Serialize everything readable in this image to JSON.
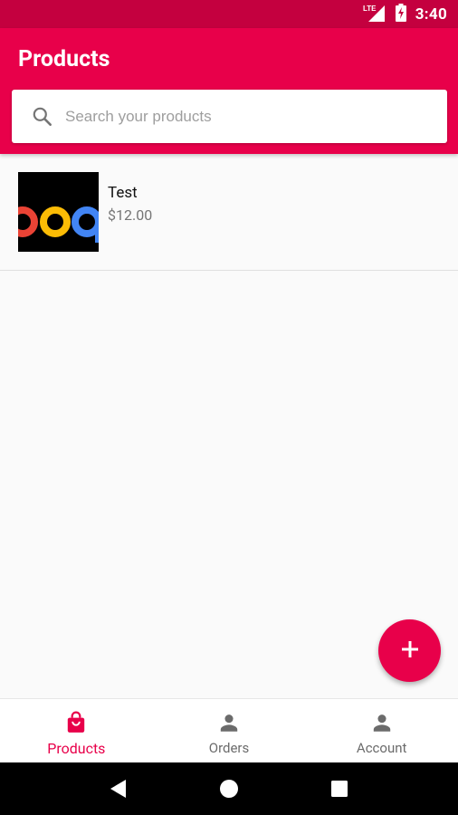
{
  "status_bar": {
    "network": "LTE",
    "time": "3:40",
    "icons": [
      "lte-signal-icon",
      "battery-charging-icon"
    ]
  },
  "app_bar": {
    "title": "Products"
  },
  "search": {
    "placeholder": "Search your products",
    "value": "",
    "icon": "search-icon"
  },
  "products": [
    {
      "name": "Test",
      "price": "$12.00",
      "thumbnail": "google-logo-thumbnail"
    }
  ],
  "fab": {
    "icon": "plus-icon"
  },
  "bottom_nav": {
    "items": [
      {
        "label": "Products",
        "icon": "shopping-bag-icon",
        "active": true
      },
      {
        "label": "Orders",
        "icon": "person-icon",
        "active": false
      },
      {
        "label": "Account",
        "icon": "person-icon",
        "active": false
      }
    ]
  },
  "system_nav": [
    "back-icon",
    "home-icon",
    "recents-icon"
  ],
  "colors": {
    "primary": "#e8004a",
    "primary_dark": "#c4003f",
    "background": "#fafafa",
    "inactive": "#6b6b6b"
  }
}
